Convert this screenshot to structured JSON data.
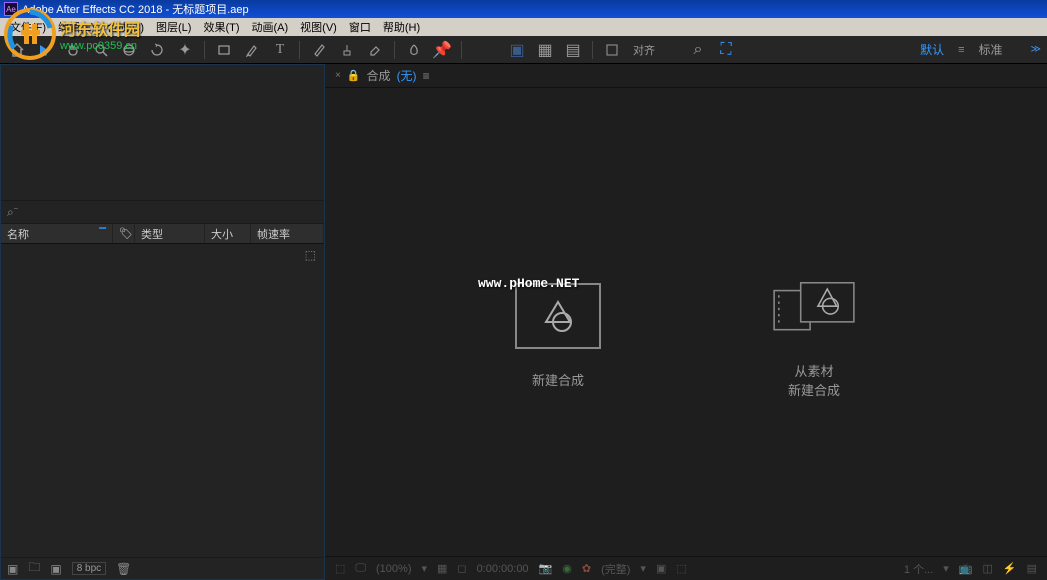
{
  "titlebar": {
    "title": "Adobe After Effects CC 2018 - 无标题项目.aep",
    "icon_text": "Ae"
  },
  "menubar": {
    "items": [
      "文件(F)",
      "编辑(E)",
      "合成(C)",
      "图层(L)",
      "效果(T)",
      "动画(A)",
      "视图(V)",
      "窗口",
      "帮助(H)"
    ]
  },
  "toolbar": {
    "align_label": "对齐",
    "workspace_default": "默认",
    "workspace_standard": "标准"
  },
  "project": {
    "search_placeholder": "",
    "columns": {
      "name": "名称",
      "type": "类型",
      "size": "大小",
      "fps": "帧速率"
    },
    "bpc": "8 bpc"
  },
  "comp": {
    "tab_label": "合成",
    "tab_none": "(无)",
    "new_comp": "新建合成",
    "from_footage": "从素材\n新建合成",
    "zoom": "(100%)",
    "timecode": "0:00:00:00",
    "quality": "(完整)",
    "camera": "1 个..."
  },
  "watermark": {
    "site_name": "河东软件园",
    "site_url": "www.pc0359.cn",
    "phome": "www.pHome.NET"
  }
}
